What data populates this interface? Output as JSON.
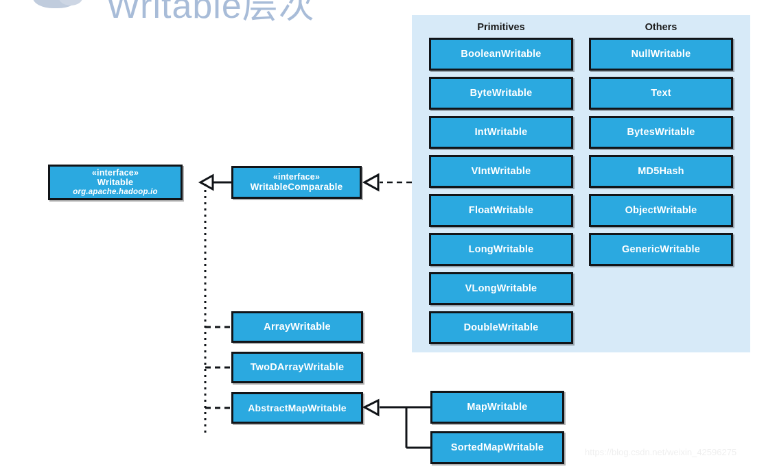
{
  "title": {
    "heading": "Writable层次",
    "logo_icon": "cloud-logo-icon"
  },
  "panel": {
    "columns": [
      {
        "header": "Primitives",
        "items": [
          "BooleanWritable",
          "ByteWritable",
          "IntWritable",
          "VIntWritable",
          "FloatWritable",
          "LongWritable",
          "VLongWritable",
          "DoubleWritable"
        ]
      },
      {
        "header": "Others",
        "items": [
          "NullWritable",
          "Text",
          "BytesWritable",
          "MD5Hash",
          "ObjectWritable",
          "GenericWritable"
        ]
      }
    ]
  },
  "classes": {
    "writable": {
      "stereotype": "«interface»",
      "name": "Writable",
      "package": "org.apache.hadoop.io"
    },
    "writable_comparable": {
      "stereotype": "«interface»",
      "name": "WritableComparable"
    },
    "array_writable": "ArrayWritable",
    "two_d_array_writable": "TwoDArrayWritable",
    "abstract_map_writable": "AbstractMapWritable",
    "map_writable": "MapWritable",
    "sorted_map_writable": "SortedMapWritable"
  },
  "colors": {
    "box_fill": "#2ba9e0",
    "box_border": "#111418",
    "panel_background": "#d7eaf8",
    "box_text": "#ffffff",
    "header_text": "#1a1a1a",
    "title_text": "#a8bcd8",
    "edge": "#111418",
    "watermark_text": "#efefef",
    "page_background": "#ffffff"
  },
  "watermark": "https://blog.csdn.net/weixin_42596275"
}
